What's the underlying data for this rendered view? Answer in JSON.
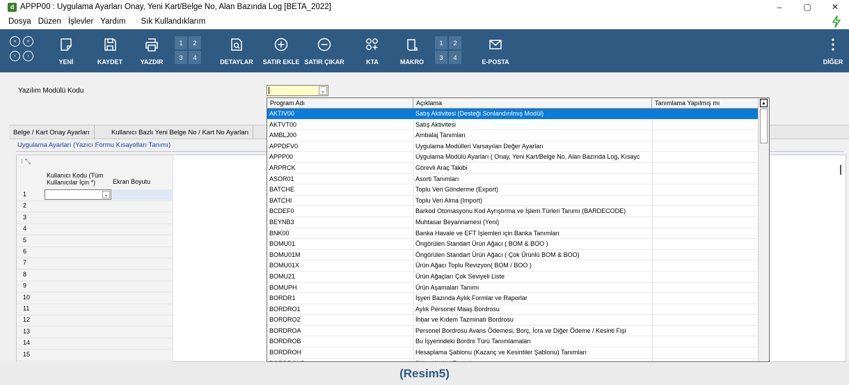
{
  "window": {
    "title": "APPP00 : Uygulama Ayarları Onay, Yeni Kart/Belge No, Alan Bazında Log [BETA_2022]",
    "icon_letter": "d",
    "controls": [
      "–",
      "▢",
      "✕"
    ]
  },
  "menu": {
    "items": [
      "Dosya",
      "Düzen",
      "İşlevler",
      "Yardım",
      "Sık Kullandıklarım"
    ]
  },
  "toolbar": {
    "yeni": "YENİ",
    "kaydet": "KAYDET",
    "yazdir": "YAZDIR",
    "detaylar": "DETAYLAR",
    "satir_ekle": "SATIR EKLE",
    "satir_cikar": "SATIR ÇIKAR",
    "kta": "KTA",
    "makro": "MAKRO",
    "eposta": "E-POSTA",
    "diger": "DİĞER",
    "nav_icons": [
      "«",
      "»",
      "‹",
      "›"
    ],
    "print_grid": [
      "1",
      "2",
      "3",
      "4"
    ],
    "macro_grid": [
      "1",
      "2",
      "3",
      "4"
    ]
  },
  "form": {
    "field_label": "Yazılım Modülü Kodu",
    "combo_value": ""
  },
  "tabs": [
    "Belge / Kart Onay Ayarları",
    "Kullanıcı Bazlı Yeni Belge No / Kart No Ayarları"
  ],
  "sub_tab": "Uygulama Ayarları (Yazıcı Formu Kısayolları Tanımı)",
  "grid": {
    "corner": "⁝ ⤡",
    "col1": "Kullanıcı Kodu (Tüm Kullanıcılar İçin *)",
    "col2": "Ekran Boyutu",
    "rows": [
      "1",
      "2",
      "3",
      "4",
      "5",
      "6",
      "7",
      "8",
      "9",
      "10",
      "11",
      "12",
      "13",
      "14",
      "15"
    ]
  },
  "dropdown": {
    "headers": [
      "Program Adı",
      "Açıklama",
      "Tanımlama Yapılmış mı"
    ],
    "rows": [
      [
        "AKTIV00",
        "Satış Aktivitesi (Desteği Sonlandırılmış Modül)"
      ],
      [
        "AKTVT00",
        "Satış Aktivitesi"
      ],
      [
        "AMBLJ00",
        "Ambalaj Tanımları"
      ],
      [
        "APPDFV0",
        "Uygulama Modülleri Varsayılan Değer Ayarları"
      ],
      [
        "APPP00",
        "Uygulama Modülü Ayarları ( Onay, Yeni Kart/Belge No, Alan Bazında Log, Kısayc"
      ],
      [
        "ARPRCK",
        "Görevli Araç Takibi"
      ],
      [
        "ASOR01",
        "Asorti Tanımları"
      ],
      [
        "BATCHE",
        "Toplu Veri Gönderme (Export)"
      ],
      [
        "BATCHI",
        "Toplu Veri Alma (Import)"
      ],
      [
        "BCDEF0",
        "Barkod Otomasyonu Kod Ayrıştırma ve İşlem Türleri Tanımı (BARDECODE)"
      ],
      [
        "BEYNB3",
        "Muhtasar Beyannamesi (Yeni)"
      ],
      [
        "BNK00",
        "Banka Havale ve EFT İşlemleri için Banka Tanımları"
      ],
      [
        "BOMU01",
        "Öngörülen Standart Ürün Ağacı ( BOM & BOO )"
      ],
      [
        "BOMU01M",
        "Öngörülen Standart Ürün Ağacı ( Çok Ürünlü BOM & BOO)"
      ],
      [
        "BOMU01X",
        "Ürün Ağacı Toplu Revizyon( BOM / BOO )"
      ],
      [
        "BOMU21",
        "Ürün Ağaçları Çok Seviyeli Liste"
      ],
      [
        "BOMUPH",
        "Ürün Aşamaları Tanımı"
      ],
      [
        "BORDR1",
        "İşyeri Bazında Aylık Formlar ve Raporlar"
      ],
      [
        "BORDRO1",
        "Aylık Personel Maaş Bordrosu"
      ],
      [
        "BORDRO2",
        "İhbar ve Kıdem Tazminatı Bordrosu"
      ],
      [
        "BORDROA",
        "Personel Bordrosu Avans Ödemesi, Borç, İcra ve Diğer Ödeme / Kesinti Fişi"
      ],
      [
        "BORDROB",
        "Bu İşyerindeki Bordro Türü Tanımlamaları"
      ],
      [
        "BORDROH",
        "Hesaplama Şablonu (Kazanç ve Kesintiler Şablonu) Tanımları"
      ],
      [
        "BORDROKD",
        "Diğer Kesinti Tanımları"
      ]
    ]
  },
  "caption": "(Resim5)",
  "colors": {
    "toolbar": "#2f5a82",
    "selection": "#0b7ad8",
    "caption": "#2f5a82"
  }
}
